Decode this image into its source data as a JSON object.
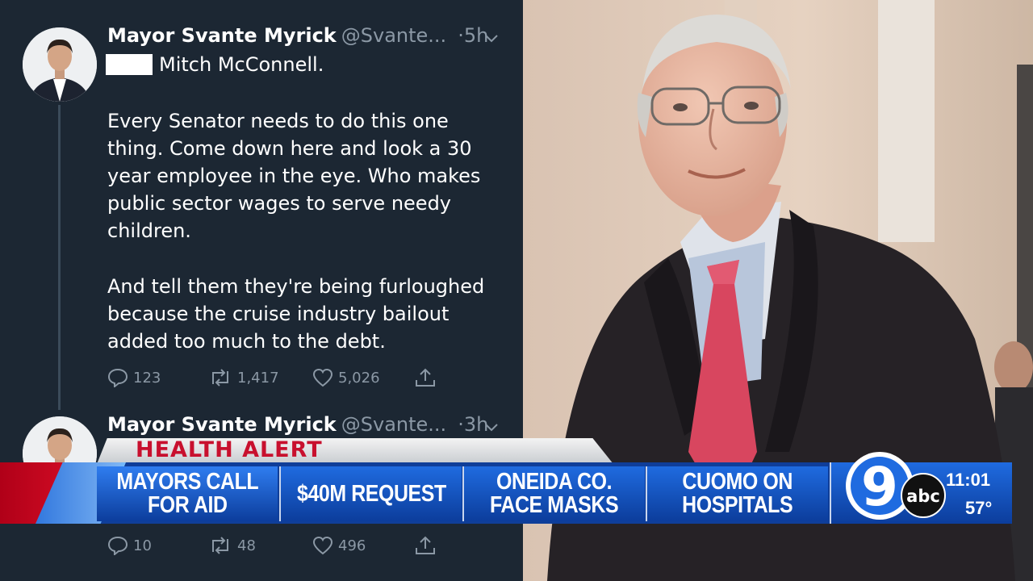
{
  "tweets": [
    {
      "name": "Mayor Svante Myrick",
      "handle": "@Svante...",
      "separator": "·",
      "time": "5h",
      "lines": [
        "Mitch McConnell.",
        "Every Senator needs to do this one",
        "thing.  Come down here and look a 30",
        "year employee in the eye. Who makes",
        "public sector wages to serve needy",
        "children.",
        "And tell them they're being furloughed",
        "because the cruise industry bailout",
        "added too much to the debt."
      ],
      "replies": "123",
      "retweets": "1,417",
      "likes": "5,026"
    },
    {
      "name": "Mayor Svante Myrick",
      "handle": "@Svante...",
      "separator": "·",
      "time": "3h",
      "replies": "10",
      "retweets": "48",
      "likes": "496"
    }
  ],
  "ticker": {
    "alert": "HEALTH ALERT",
    "segments": [
      "MAYORS CALL\nFOR AID",
      "$40M REQUEST",
      "ONEIDA CO.\nFACE MASKS",
      "CUOMO ON\nHOSPITALS"
    ],
    "logo_number": "9",
    "logo_network": "abc",
    "time": "11:01",
    "temperature": "57°"
  },
  "colors": {
    "tweet_bg": "#1c2733",
    "alert_red": "#c8102e",
    "ticker_blue": "#0f3e99"
  },
  "icons": [
    "reply-icon",
    "retweet-icon",
    "like-icon",
    "share-icon",
    "chevron-down-icon"
  ]
}
